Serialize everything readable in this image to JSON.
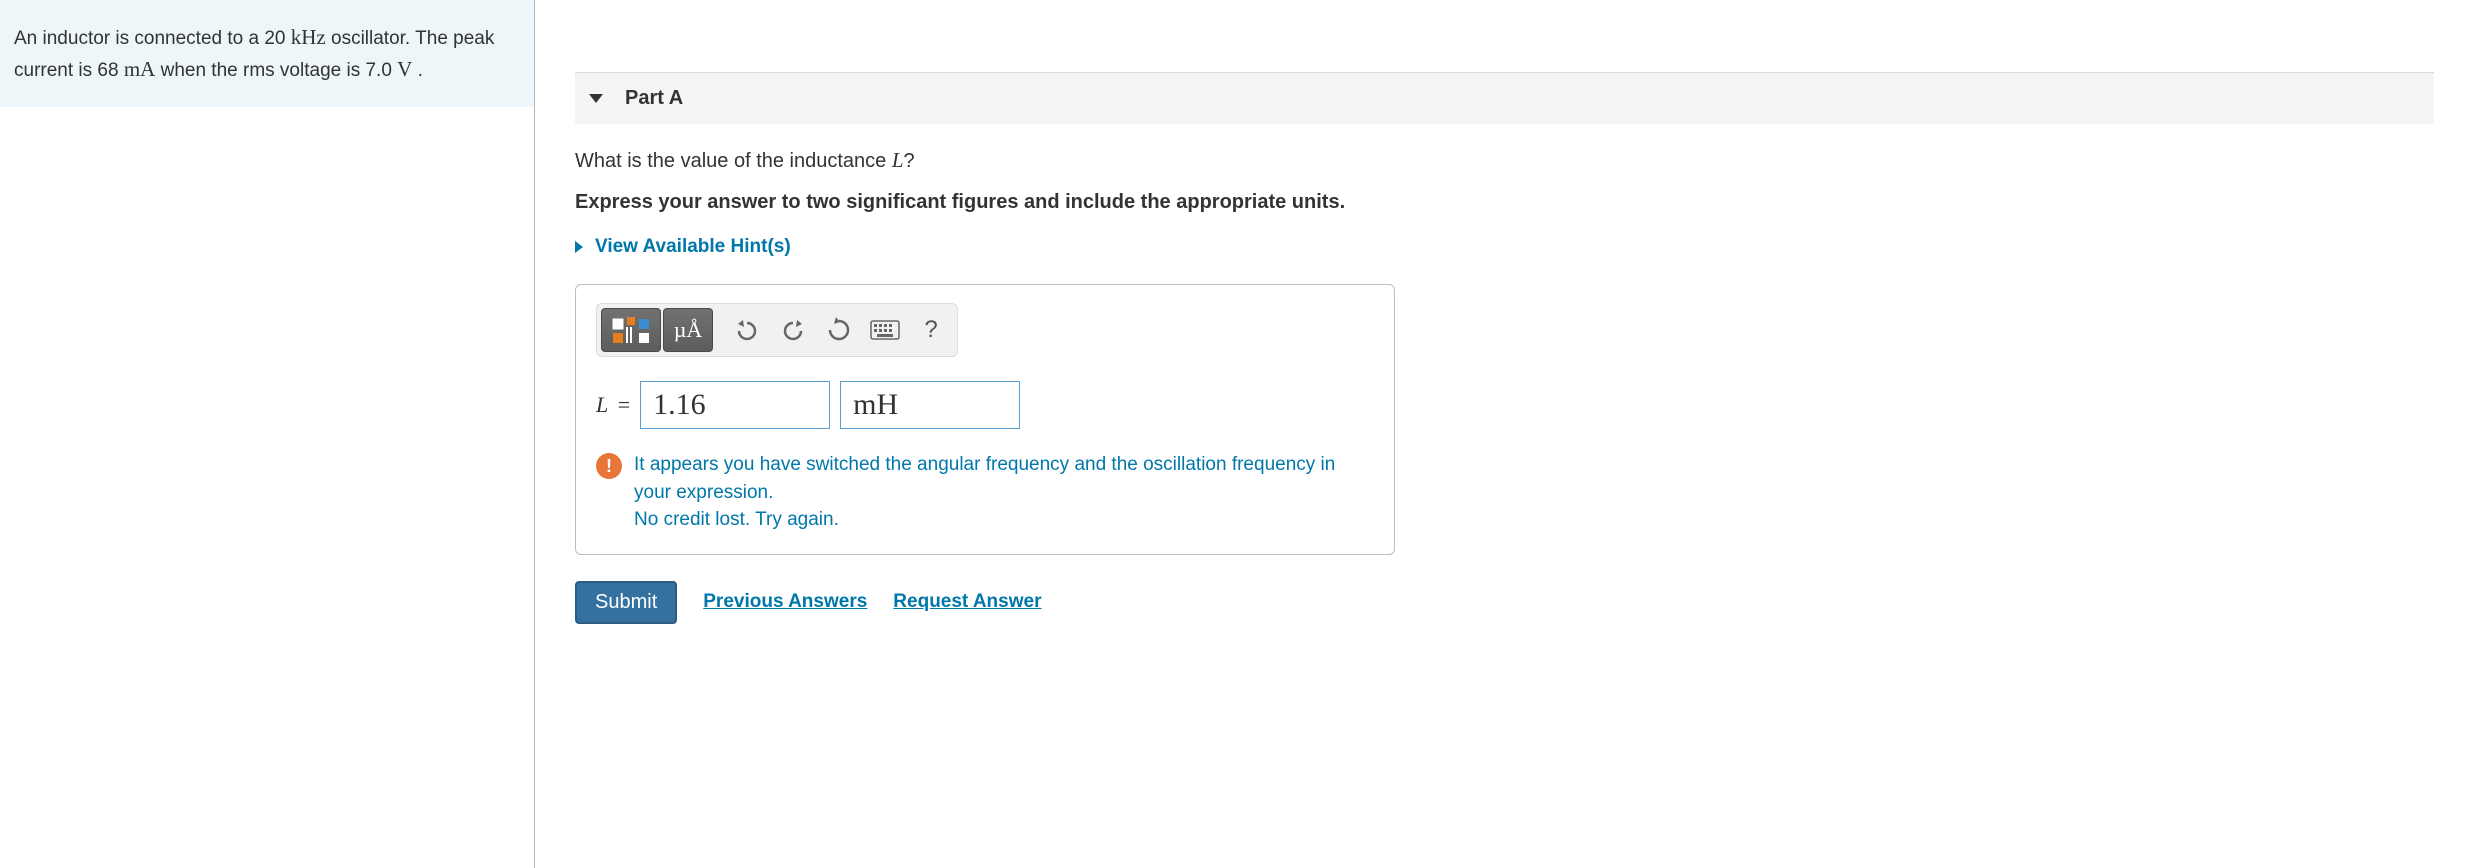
{
  "problem": {
    "text_before_freq": "An inductor is connected to a 20 ",
    "freq_unit": "kHz",
    "text_after_freq": " oscillator. The peak current is 68 ",
    "current_unit": "mA",
    "text_after_current": " when the rms voltage is 7.0 ",
    "voltage_unit": "V",
    "text_end": " ."
  },
  "part": {
    "label": "Part A",
    "question_before": "What is the value of the inductance ",
    "question_var": "L",
    "question_after": "?",
    "instruction": "Express your answer to two significant figures and include the appropriate units.",
    "hints_label": "View Available Hint(s)"
  },
  "toolbar": {
    "units_button": "µÅ",
    "help_label": "?"
  },
  "answer": {
    "prefix_var": "L",
    "prefix_eq": " =",
    "value": "1.16",
    "unit": "mH"
  },
  "feedback": {
    "icon": "!",
    "line1": "It appears you have switched the angular frequency and the oscillation frequency in your expression.",
    "line2": "No credit lost. Try again."
  },
  "actions": {
    "submit": "Submit",
    "previous": "Previous Answers",
    "request": "Request Answer"
  }
}
